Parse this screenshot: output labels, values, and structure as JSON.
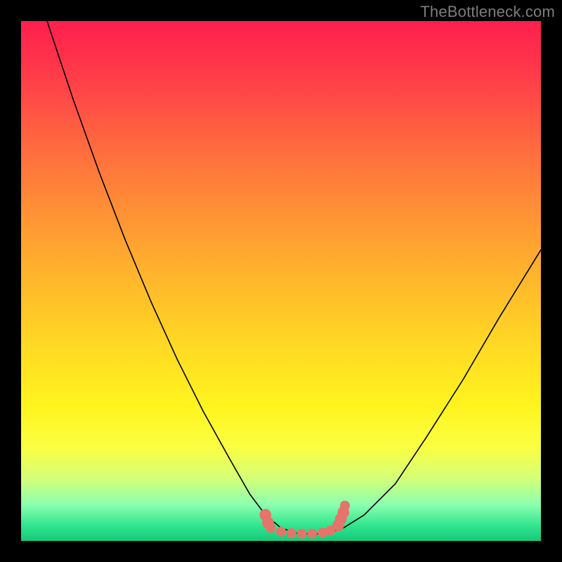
{
  "watermark": "TheBottleneck.com",
  "colors": {
    "frame": "#000000",
    "gradient_top": "#ff1f4d",
    "gradient_bottom": "#16c97a",
    "curve": "#000000",
    "marker": "#e5746b",
    "watermark": "#7d7d7d"
  },
  "chart_data": {
    "type": "line",
    "title": "",
    "xlabel": "",
    "ylabel": "",
    "xlim": [
      0,
      100
    ],
    "ylim": [
      0,
      100
    ],
    "grid": false,
    "legend": false,
    "background": "red-yellow-green vertical gradient (high=red top, low=green bottom)",
    "series": [
      {
        "name": "bottleneck-curve",
        "description": "V-shaped curve: steep descent from top-left, flat minimum near x≈50–60, rises toward upper-right",
        "x": [
          5,
          10,
          15,
          20,
          25,
          30,
          35,
          40,
          44,
          47,
          50,
          53,
          56,
          59,
          62,
          66,
          72,
          78,
          85,
          92,
          100
        ],
        "y": [
          100,
          85,
          71,
          58,
          46,
          35,
          25,
          16,
          9,
          5,
          2.5,
          1.5,
          1.3,
          1.5,
          2.5,
          5,
          11,
          20,
          31,
          43,
          56
        ]
      }
    ],
    "markers": {
      "description": "Cluster of salmon dots along the flat minimum of the curve",
      "approx_points": [
        {
          "x": 47,
          "y": 5.0,
          "r": 1.2
        },
        {
          "x": 47.5,
          "y": 3.5,
          "r": 1.2
        },
        {
          "x": 48,
          "y": 2.5,
          "r": 1.0
        },
        {
          "x": 50,
          "y": 1.8,
          "r": 1.0
        },
        {
          "x": 52,
          "y": 1.5,
          "r": 1.0
        },
        {
          "x": 54,
          "y": 1.4,
          "r": 1.0
        },
        {
          "x": 56,
          "y": 1.4,
          "r": 1.0
        },
        {
          "x": 58,
          "y": 1.6,
          "r": 1.0
        },
        {
          "x": 59.5,
          "y": 2.0,
          "r": 1.0
        },
        {
          "x": 61,
          "y": 3.0,
          "r": 1.2
        },
        {
          "x": 61.5,
          "y": 4.2,
          "r": 1.2
        },
        {
          "x": 62,
          "y": 5.5,
          "r": 1.2
        },
        {
          "x": 62.3,
          "y": 6.8,
          "r": 1.0
        }
      ]
    }
  }
}
